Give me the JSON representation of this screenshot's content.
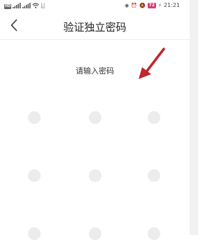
{
  "status_bar": {
    "hd_badge": "HD",
    "signal_1": "4G",
    "signal_2": "4G",
    "net_speed_value": "1.1",
    "net_speed_unit": "K/s",
    "battery": "72",
    "time": "21:21"
  },
  "nav": {
    "title": "验证独立密码"
  },
  "prompt": "请输入密码",
  "colors": {
    "battery_accent": "#d63c73",
    "annotation_arrow": "#c0262c",
    "key_dot": "#ececec"
  }
}
